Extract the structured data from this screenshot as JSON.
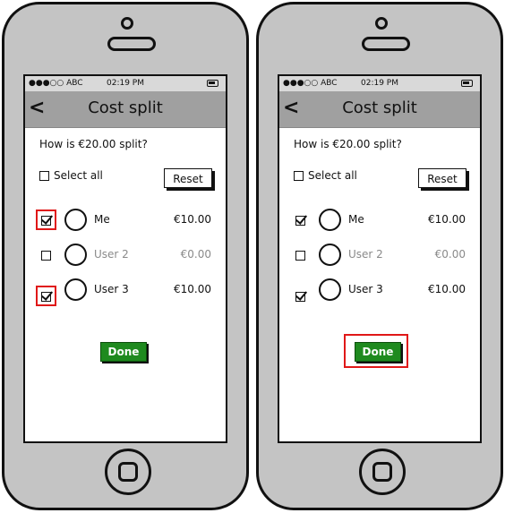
{
  "statusbar": {
    "carrier": "●●●○○ ABC",
    "time": "02:19 PM"
  },
  "navbar": {
    "back": "<",
    "title": "Cost split"
  },
  "content": {
    "question": "How is €20.00 split?",
    "select_all_label": "Select all",
    "reset_label": "Reset",
    "done_label": "Done"
  },
  "rows": [
    {
      "name": "Me",
      "amount": "€10.00",
      "checked": true
    },
    {
      "name": "User 2",
      "amount": "€0.00",
      "checked": false
    },
    {
      "name": "User 3",
      "amount": "€10.00",
      "checked": true
    }
  ],
  "highlight_color": "#e01818",
  "done_color": "#1f8a1f"
}
